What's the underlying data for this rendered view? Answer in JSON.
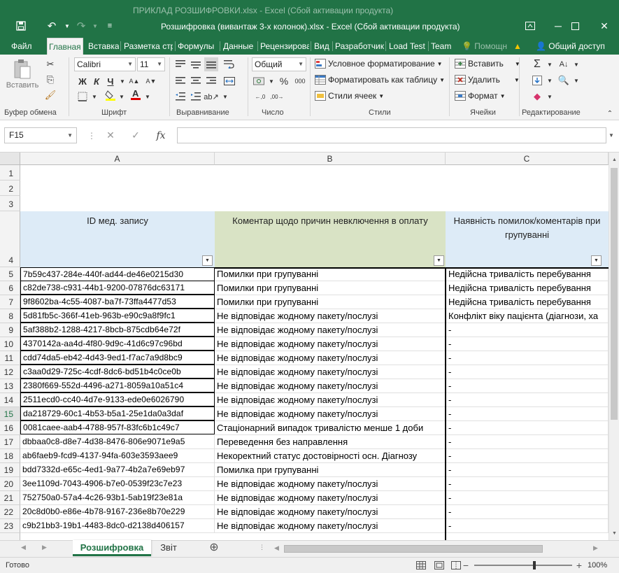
{
  "window": {
    "ghost_title": "ПРИКЛАД РОЗШИФРОВКИ.xlsx - Excel (Сбой активации продукта)",
    "title": "Розшифровка (вивантаж 3-х колонок).xlsx - Excel (Сбой активации продукта)"
  },
  "tabs": [
    "Файл",
    "Главная",
    "Вставка",
    "Разметка стр",
    "Формулы",
    "Данные",
    "Рецензирова",
    "Вид",
    "Разработчик",
    "Load Test",
    "Team"
  ],
  "tell_me": "Помощн",
  "share": "Общий доступ",
  "ribbon": {
    "paste": "Вставить",
    "font_name": "Calibri",
    "font_size": "11",
    "bold": "Ж",
    "italic": "К",
    "underline": "Ч",
    "number_format": "Общий",
    "conditional": "Условное форматирование",
    "format_table": "Форматировать как таблицу",
    "cell_styles": "Стили ячеек",
    "insert": "Вставить",
    "delete": "Удалить",
    "format": "Формат",
    "group_labels": {
      "clipboard": "Буфер обмена",
      "font": "Шрифт",
      "alignment": "Выравнивание",
      "number": "Число",
      "styles": "Стили",
      "cells": "Ячейки",
      "editing": "Редактирование"
    }
  },
  "formula_bar": {
    "name_box": "F15",
    "fx": "fx",
    "content": ""
  },
  "columns": [
    "A",
    "B",
    "C"
  ],
  "header_row": {
    "row": "4",
    "a": "ID мед. запису",
    "b": "Коментар щодо причин невключення в оплату",
    "c": "Наявність помилок/коментарів при групуванні"
  },
  "empty_rows": [
    "1",
    "2",
    "3"
  ],
  "rows": [
    {
      "n": "5",
      "a": "7b59c437-284e-440f-ad44-de46e0215d30",
      "b": "Помилки при групуванні",
      "c": "Недійсна тривалість перебування"
    },
    {
      "n": "6",
      "a": "c82de738-c931-44b1-9200-07876dc63171",
      "b": "Помилки при групуванні",
      "c": "Недійсна тривалість перебування"
    },
    {
      "n": "7",
      "a": "9f8602ba-4c55-4087-ba7f-73ffa4477d53",
      "b": "Помилки при групуванні",
      "c": "Недійсна тривалість перебування"
    },
    {
      "n": "8",
      "a": "5d81fb5c-366f-41eb-963b-e90c9a8f9fc1",
      "b": "Не відповідає жодному пакету/послузі",
      "c": "Конфлікт віку пацієнта (діагнози, ха"
    },
    {
      "n": "9",
      "a": "5af388b2-1288-4217-8bcb-875cdb64e72f",
      "b": "Не відповідає жодному пакету/послузі",
      "c": "-"
    },
    {
      "n": "10",
      "a": "4370142a-aa4d-4f80-9d9c-41d6c97c96bd",
      "b": "Не відповідає жодному пакету/послузі",
      "c": "-"
    },
    {
      "n": "11",
      "a": "cdd74da5-eb42-4d43-9ed1-f7ac7a9d8bc9",
      "b": "Не відповідає жодному пакету/послузі",
      "c": "-"
    },
    {
      "n": "12",
      "a": "c3aa0d29-725c-4cdf-8dc6-bd51b4c0ce0b",
      "b": "Не відповідає жодному пакету/послузі",
      "c": "-"
    },
    {
      "n": "13",
      "a": "2380f669-552d-4496-a271-8059a10a51c4",
      "b": "Не відповідає жодному пакету/послузі",
      "c": "-"
    },
    {
      "n": "14",
      "a": "2511ecd0-cc40-4d7e-9133-ede0e6026790",
      "b": "Не відповідає жодному пакету/послузі",
      "c": "-"
    },
    {
      "n": "15",
      "a": "da218729-60c1-4b53-b5a1-25e1da0a3daf",
      "b": "Не відповідає жодному пакету/послузі",
      "c": "-"
    },
    {
      "n": "16",
      "a": "0081caee-aab4-4788-957f-83fc6b1c49c7",
      "b": "Стаціонарний випадок тривалістю менше 1 доби",
      "c": "-"
    },
    {
      "n": "17",
      "a": "dbbaa0c8-d8e7-4d38-8476-806e9071e9a5",
      "b": "Переведення без направлення",
      "c": "-"
    },
    {
      "n": "18",
      "a": "ab6faeb9-fcd9-4137-94fa-603e3593aee9",
      "b": "Некоректний статус достовірності осн. Діагнозу",
      "c": "-"
    },
    {
      "n": "19",
      "a": "bdd7332d-e65c-4ed1-9a77-4b2a7e69eb97",
      "b": "Помилка при групуванні",
      "c": "-"
    },
    {
      "n": "20",
      "a": "3ee1109d-7043-4906-b7e0-0539f23c7e23",
      "b": "Не відповідає жодному пакету/послузі",
      "c": "-"
    },
    {
      "n": "21",
      "a": "752750a0-57a4-4c26-93b1-5ab19f23e81a",
      "b": "Не відповідає жодному пакету/послузі",
      "c": "-"
    },
    {
      "n": "22",
      "a": "20c8d0b0-e86e-4b78-9167-236e8b70e229",
      "b": "Не відповідає жодному пакету/послузі",
      "c": "-"
    },
    {
      "n": "23",
      "a": "c9b21bb3-19b1-4483-8dc0-d2138d406157",
      "b": "Не відповідає жодному пакету/послузі",
      "c": "-"
    }
  ],
  "sheets": [
    "Розшифровка",
    "Звіт"
  ],
  "status": {
    "ready": "Готово",
    "zoom": "100%"
  },
  "colors": {
    "excel_green": "#217346",
    "header_a": "#ddebf7",
    "header_b": "#d9e3c5",
    "header_c": "#ddebf7"
  }
}
